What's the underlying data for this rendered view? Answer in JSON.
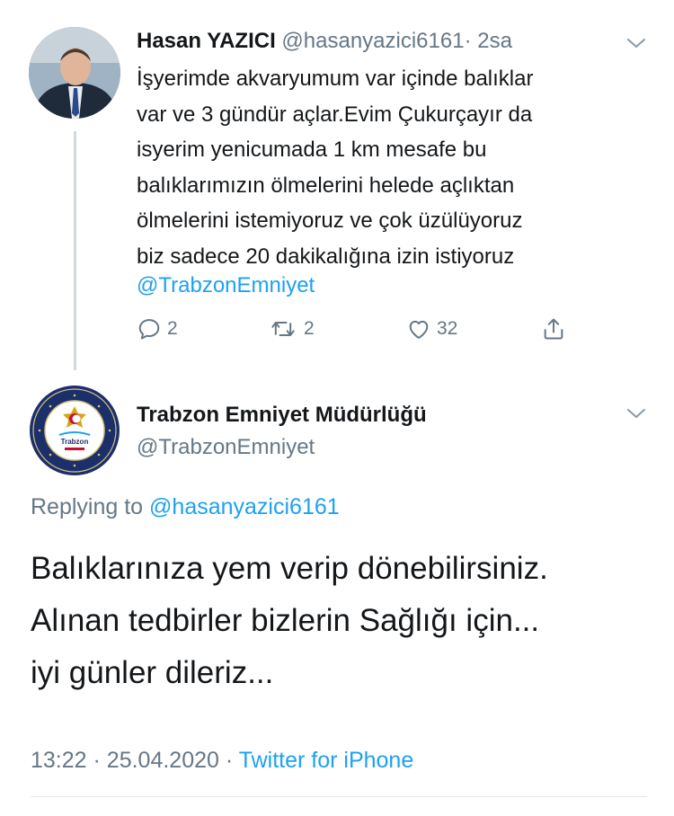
{
  "tweet": {
    "author_name": "Hasan YAZICI",
    "author_handle": "@hasanyazici6161",
    "separator": "·",
    "time_ago": "2sa",
    "text": "İşyerimde akvaryumum var içinde balıklar\nvar ve 3 gündür açlar.Evim Çukurçayır da\nisyerim yenicumada 1 km mesafe bu\nbalıklarımızın ölmelerini helede açlıktan\nölmelerini istemiyoruz ve çok üzülüyoruz\nbiz sadece 20 dakikalığına izin istiyoruz",
    "mention": "@TrabzonEmniyet",
    "reply_count": "2",
    "retweet_count": "2",
    "like_count": "32"
  },
  "reply": {
    "author_name": "Trabzon Emniyet Müdürlüğü",
    "author_handle": "@TrabzonEmniyet",
    "replying_label": "Replying to",
    "replying_handle": "@hasanyazici6161",
    "text": "Balıklarınıza yem verip dönebilirsiniz.\nAlınan tedbirler bizlerin Sağlığı için...\niyi günler dileriz...",
    "time": "13:22",
    "date": "25.04.2020",
    "dot": "·",
    "source": "Twitter for iPhone",
    "logo_text": "Trabzon"
  },
  "icons": {
    "reply": "reply-icon",
    "retweet": "retweet-icon",
    "like": "heart-icon",
    "share": "share-icon",
    "menu": "chevron-down-icon"
  },
  "colors": {
    "accent": "#1da1f2",
    "muted": "#657786",
    "text": "#14171a"
  }
}
